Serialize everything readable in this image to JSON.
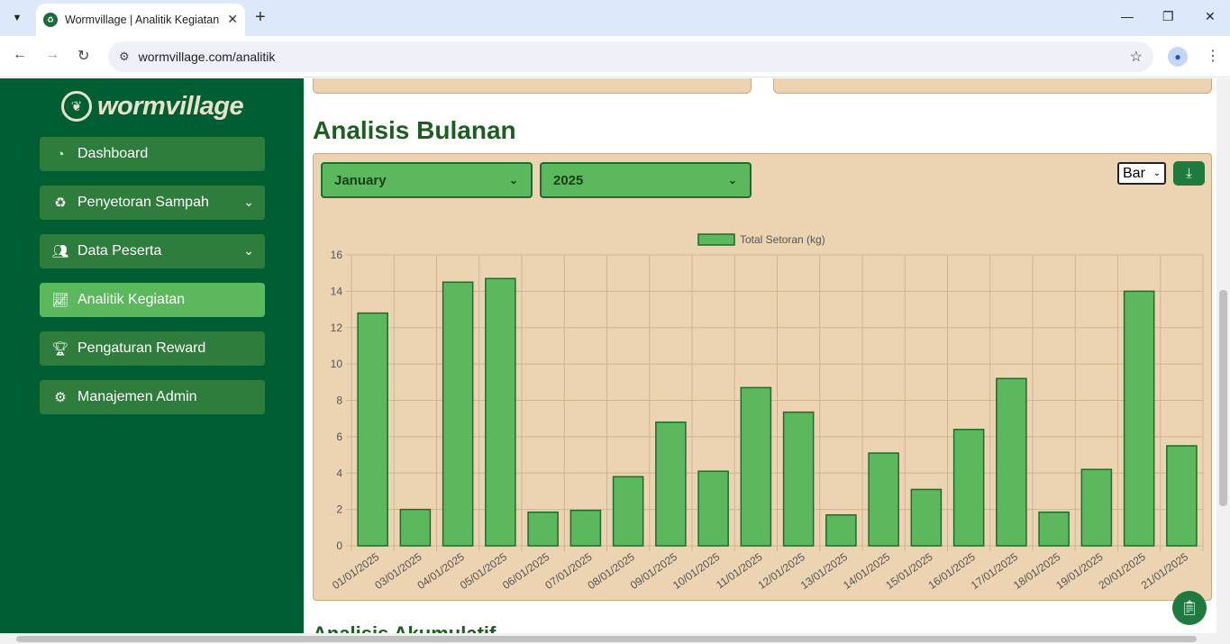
{
  "browser": {
    "tab_title": "Wormvillage | Analitik Kegiatan",
    "url": "wormvillage.com/analitik"
  },
  "sidebar": {
    "logo_text": "wormvillage",
    "items": [
      {
        "label": "Dashboard",
        "icon": "gauge-icon",
        "has_submenu": false,
        "active": false
      },
      {
        "label": "Penyetoran Sampah",
        "icon": "recycle-icon",
        "has_submenu": true,
        "active": false
      },
      {
        "label": "Data Peserta",
        "icon": "users-icon",
        "has_submenu": true,
        "active": false
      },
      {
        "label": "Analitik Kegiatan",
        "icon": "chart-line-icon",
        "has_submenu": false,
        "active": true
      },
      {
        "label": "Pengaturan Reward",
        "icon": "trophy-icon",
        "has_submenu": false,
        "active": false
      },
      {
        "label": "Manajemen Admin",
        "icon": "user-gear-icon",
        "has_submenu": false,
        "active": false
      }
    ]
  },
  "main": {
    "section_title": "Analisis Bulanan",
    "month_select": "January",
    "year_select": "2025",
    "chart_type_select": "Bar",
    "next_section_title": "Analisis Akumulatif"
  },
  "colors": {
    "sidebar_bg": "#005f32",
    "menu_item": "#2e7d3c",
    "menu_active": "#5cb85c",
    "panel_bg": "#ecd3b1",
    "bar_fill": "#5cb85c",
    "bar_stroke": "#1e6b2f",
    "title_green": "#1b5e20"
  },
  "chart_data": {
    "type": "bar",
    "categories": [
      "01/01/2025",
      "03/01/2025",
      "04/01/2025",
      "05/01/2025",
      "06/01/2025",
      "07/01/2025",
      "08/01/2025",
      "09/01/2025",
      "10/01/2025",
      "11/01/2025",
      "12/01/2025",
      "13/01/2025",
      "14/01/2025",
      "15/01/2025",
      "16/01/2025",
      "17/01/2025",
      "18/01/2025",
      "19/01/2025",
      "20/01/2025",
      "21/01/2025"
    ],
    "series": [
      {
        "name": "Total Setoran (kg)",
        "values": [
          12.8,
          2.0,
          14.5,
          14.7,
          1.85,
          1.95,
          3.8,
          6.8,
          4.1,
          8.7,
          7.35,
          1.7,
          5.1,
          3.1,
          6.4,
          9.2,
          1.85,
          4.2,
          14.0,
          5.5
        ]
      }
    ],
    "ylim": [
      0,
      16
    ],
    "yticks": [
      0,
      2,
      4,
      6,
      8,
      10,
      12,
      14,
      16
    ],
    "grid": true,
    "legend_position": "top-center"
  }
}
